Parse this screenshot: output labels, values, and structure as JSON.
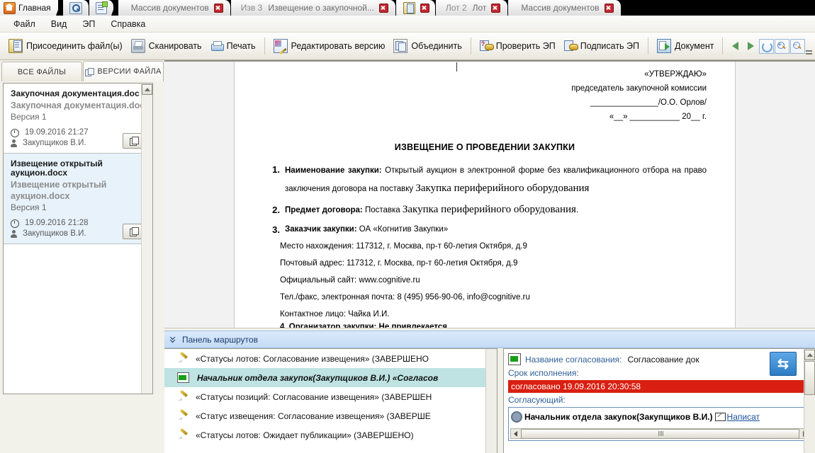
{
  "tabs": [
    {
      "label": "Главная",
      "icon": "home-icon",
      "active": true,
      "closable": false,
      "index": ""
    },
    {
      "label": "",
      "icon": "search-doc-icon",
      "active": false,
      "closable": false,
      "index": ""
    },
    {
      "label": "",
      "icon": "new-doc-icon",
      "active": false,
      "closable": false,
      "index": ""
    },
    {
      "label": "Массив документов",
      "icon": "",
      "active": false,
      "closable": true,
      "index": ""
    },
    {
      "label": "Извещение о закупочной...",
      "icon": "",
      "active": false,
      "closable": true,
      "index": "Изв 3"
    },
    {
      "label": "",
      "icon": "book-icon",
      "active": true,
      "closable": true,
      "index": ""
    },
    {
      "label": "Лот",
      "icon": "",
      "active": false,
      "closable": true,
      "index": "Лот 2"
    },
    {
      "label": "Массив документов",
      "icon": "",
      "active": false,
      "closable": true,
      "index": ""
    }
  ],
  "menu": [
    "Файл",
    "Вид",
    "ЭП",
    "Справка"
  ],
  "toolbar": {
    "buttons": [
      {
        "label": "Присоединить файл(ы)",
        "icon": "attach-file-icon"
      },
      {
        "label": "Сканировать",
        "icon": "scanner-icon"
      },
      {
        "label": "Печать",
        "icon": "printer-icon"
      },
      {
        "label": "Редактировать версию",
        "icon": "edit-version-icon"
      },
      {
        "label": "Объединить",
        "icon": "merge-icon"
      },
      {
        "label": "Проверить ЭП",
        "icon": "verify-signature-icon"
      },
      {
        "label": "Подписать ЭП",
        "icon": "sign-icon"
      },
      {
        "label": "Документ",
        "icon": "document-icon"
      }
    ],
    "nav": [
      "prev-page-icon",
      "next-page-icon",
      "refresh-icon",
      "zoom-in-icon",
      "zoom-out-icon"
    ]
  },
  "left_panel": {
    "tabs": [
      {
        "label": "ВСЕ ФАЙЛЫ",
        "selected": false
      },
      {
        "label": "ВЕРСИИ ФАЙЛА",
        "selected": true,
        "icon": "versions-icon"
      }
    ],
    "files": [
      {
        "name": "Закупочная документация.doc",
        "subname": "Закупочная документация.doc",
        "version": "Версия 1",
        "date": "19.09.2016 21:27",
        "user": "Закупщиков В.И.",
        "highlighted": false
      },
      {
        "name": "Извещение открытый аукцион.docx",
        "subname": "Извещение открытый аукцион.docx",
        "version": "Версия 1",
        "date": "19.09.2016 21:28",
        "user": "Закупщиков В.И.",
        "highlighted": true
      }
    ]
  },
  "document": {
    "header_lines": [
      "«УТВЕРЖДАЮ»",
      "председатель закупочной комиссии",
      "_______________/О.О. Орлов/",
      "«__» ___________ 20__ г."
    ],
    "title": "ИЗВЕЩЕНИЕ О ПРОВЕДЕНИИ ЗАКУПКИ",
    "items": [
      {
        "num": "1.",
        "bold": "Наименование закупки:",
        "text": " Открытый аукцион в электронной форме без квалификационного отбора на право заключения договора на поставку ",
        "serif": "Закупка периферийного оборудования"
      },
      {
        "num": "2.",
        "bold": "Предмет договора:",
        "text": " Поставка ",
        "serif": "Закупка периферийного оборудования",
        "tail": "."
      },
      {
        "num": "3.",
        "bold": "Заказчик закупки:",
        "text": " ОА «Когнитив Закупки»"
      }
    ],
    "details": [
      "Место нахождения: 117312, г. Москва, пр-т 60-летия Октября, д.9",
      "Почтовый адрес: 117312, г. Москва, пр-т 60-летия Октября, д.9",
      "Официальный сайт: www.cognitive.ru",
      "Тел./факс, электронная почта: 8 (495) 956-90-06, info@cognitive.ru",
      "Контактное лицо: Чайка И.И."
    ],
    "cut_line": "4.   Организатор закупки: Не привлекается"
  },
  "routes": {
    "panel_title": "Панель маршрутов",
    "rows": [
      {
        "icon": "pencil-icon",
        "text": "«Статусы лотов: Согласование извещения» (ЗАВЕРШЕНО",
        "selected": false
      },
      {
        "icon": "approval-icon",
        "text": "Начальник отдела закупок(Закупщиков В.И.) «Согласов",
        "selected": true
      },
      {
        "icon": "pencil-icon",
        "text": "«Статусы позиций: Согласование извещения» (ЗАВЕРШЕН",
        "selected": false
      },
      {
        "icon": "pencil-icon",
        "text": "«Статус извещения: Согласование извещения» (ЗАВЕРШЕ",
        "selected": false
      },
      {
        "icon": "pencil-icon",
        "text": "«Статусы лотов: Ожидает публикации» (ЗАВЕРШЕНО)",
        "selected": false
      }
    ],
    "detail": {
      "name_label": "Название согласования:",
      "name_value": "Согласование док",
      "deadline_label": "Срок исполнения:",
      "status_value": "согласовано 19.09.2016 20:30:58",
      "approver_label": "Согласующий:",
      "approver_name": "Начальник отдела закупок(Закупщиков В.И.)",
      "write_link": "Написат",
      "return_button": "return-arrow-icon"
    }
  },
  "colors": {
    "status_red": "#d91f11",
    "selected_row": "#bfe3e3",
    "panel_header": "#c4dbf6",
    "link_blue": "#1a4f9c",
    "label_blue": "#2f6096"
  }
}
